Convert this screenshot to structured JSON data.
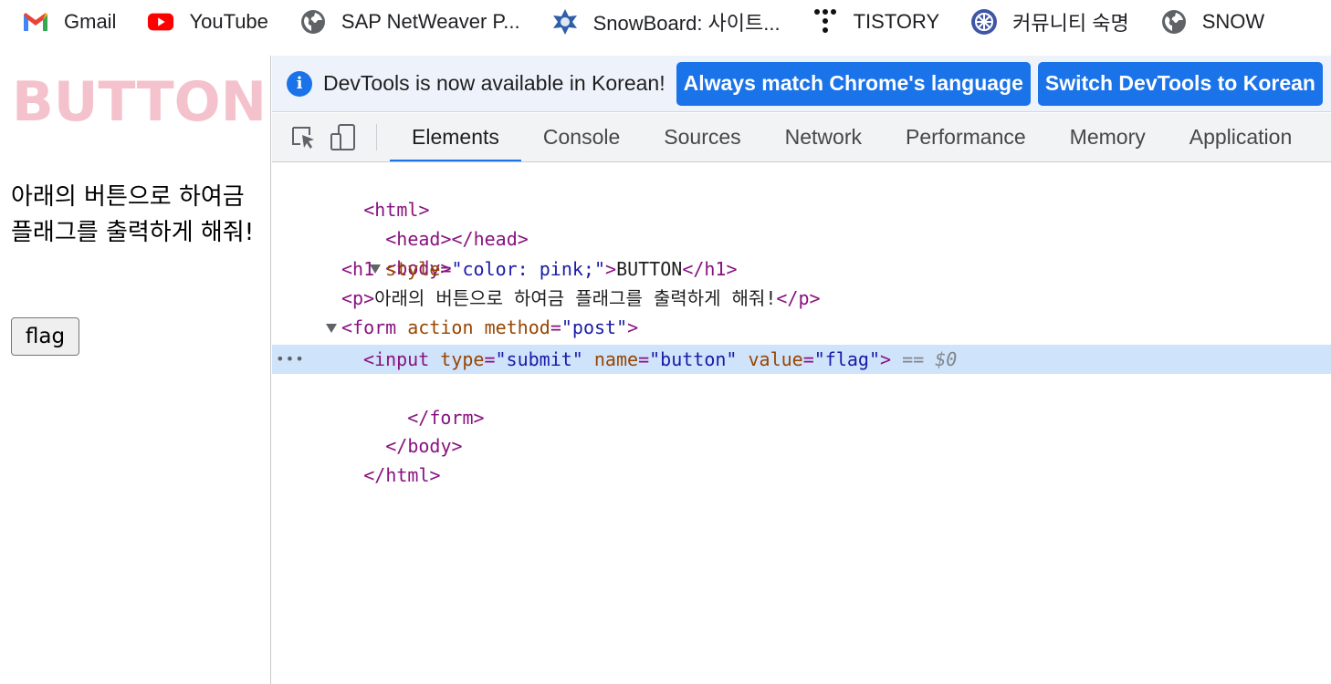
{
  "bookmarks": [
    {
      "label": "Gmail",
      "icon": "gmail-icon"
    },
    {
      "label": "YouTube",
      "icon": "youtube-icon"
    },
    {
      "label": "SAP NetWeaver P...",
      "icon": "globe-icon"
    },
    {
      "label": "SnowBoard: 사이트...",
      "icon": "snowflake-icon"
    },
    {
      "label": "TISTORY",
      "icon": "tistory-icon"
    },
    {
      "label": "커뮤니티 숙명",
      "icon": "community-icon"
    },
    {
      "label": "SNOW",
      "icon": "globe-icon"
    }
  ],
  "page": {
    "heading": "BUTTON",
    "heading_color": "#f4c2cc",
    "paragraph": "아래의 버튼으로 하여금 플래그를 출력하게 해줘!",
    "button_value": "flag"
  },
  "devtools": {
    "infobar": {
      "message": "DevTools is now available in Korean!",
      "btn_match": "Always match Chrome's language",
      "btn_switch": "Switch DevTools to Korean"
    },
    "tabs": [
      "Elements",
      "Console",
      "Sources",
      "Network",
      "Performance",
      "Memory",
      "Application"
    ],
    "active_tab": "Elements",
    "accent_color": "#1a73e8",
    "tree": {
      "html_open": "<html>",
      "head": "<head></head>",
      "body_open": "<body>",
      "h1_tag_open": "<h1",
      "h1_attr": "style",
      "h1_val": "\"color: pink;\"",
      "h1_text": "BUTTON",
      "h1_close": "</h1>",
      "p_open": "<p>",
      "p_text": "아래의 버튼으로 하여금 플래그를 출력하게 해줘!",
      "p_close": "</p>",
      "form_open": "<form",
      "form_attr1": "action",
      "form_attr2": "method",
      "form_val2": "\"post\"",
      "input_open": "<input",
      "input_attr1": "type",
      "input_val1": "\"submit\"",
      "input_attr2": "name",
      "input_val2": "\"button\"",
      "input_attr3": "value",
      "input_val3": "\"flag\"",
      "selected_marker": "== $0",
      "form_close": "</form>",
      "body_close": "</body>",
      "html_close": "</html>",
      "ellipsis": "•••"
    }
  }
}
